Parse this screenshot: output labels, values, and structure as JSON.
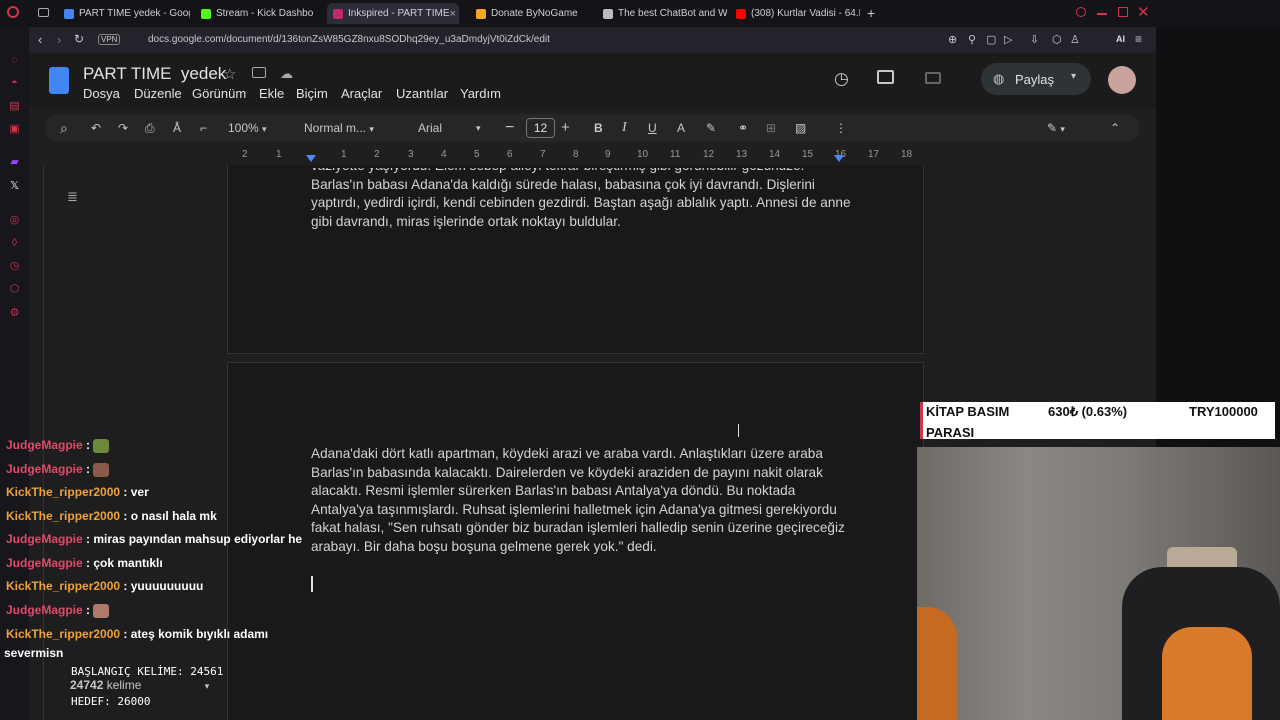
{
  "browser": {
    "tabs": [
      {
        "label": "PART TIME yedek - Goog",
        "color": "#4285f4",
        "active": false
      },
      {
        "label": "Stream - Kick Dashbo",
        "color": "#53fc18",
        "active": false
      },
      {
        "label": "Inkspired - PART TIME",
        "color": "#c02a6b",
        "active": true,
        "close": "×"
      },
      {
        "label": "Donate ByNoGame",
        "color": "#f5a623",
        "active": false
      },
      {
        "label": "The best ChatBot and Wi",
        "color": "#bbbbbb",
        "active": false
      },
      {
        "label": "(308) Kurtlar Vadisi - 64.B",
        "color": "#ff0000",
        "active": false
      }
    ],
    "new_tab": "+",
    "vpn_label": "VPN",
    "url": "docs.google.com/document/d/136tonZsW85GZ8nxu8SODhq29ey_u3aDmdyjVt0iZdCk/edit",
    "ai_label": "AI"
  },
  "docs": {
    "title": "PART TIME  yedek",
    "menus": [
      "Dosya",
      "Düzenle",
      "Görünüm",
      "Ekle",
      "Biçim",
      "Araçlar",
      "Uzantılar",
      "Yardım"
    ],
    "share_label": "Paylaş",
    "toolbar": {
      "zoom": "100%",
      "style": "Normal m...",
      "font": "Arial",
      "font_size": "12",
      "minus": "−",
      "plus": "+",
      "bold": "B",
      "italic": "I",
      "underline": "U",
      "text_color": "A"
    },
    "ruler_numbers": [
      "2",
      "1",
      "1",
      "2",
      "3",
      "4",
      "5",
      "6",
      "7",
      "8",
      "9",
      "10",
      "11",
      "12",
      "13",
      "14",
      "15",
      "16",
      "17",
      "18"
    ],
    "page1_text": "vaziyette yaşıyordu. Elem sebep aileyi tekrar bireştirmiş gibi görünebilir gözünüze. Barlas'ın babası Adana'da kaldığı sürede halası, babasına çok iyi davrandı. Dişlerini yaptırdı, yedirdi içirdi, kendi cebinden gezdirdi. Baştan aşağı ablalık yaptı. Annesi de anne gibi davrandı, miras işlerinde ortak noktayı buldular.",
    "page2_text": "Adana'daki dört katlı apartman, köydeki arazi ve araba vardı. Anlaştıkları üzere araba Barlas'ın babasında kalacaktı. Dairelerden ve köydeki araziden de payını nakit olarak alacaktı. Resmi işlemler sürerken Barlas'ın babası Antalya'ya döndü. Bu noktada Antalya'ya taşınmışlardı. Ruhsat işlemlerini halletmek için Adana'ya gitmesi gerekiyordu fakat halası, \"Sen ruhsatı gönder biz buradan işlemleri halledip senin üzerine geçireceğiz arabayı. Bir daha boşu boşuna gelmene gerek yok.\" dedi.",
    "word_count": "24742",
    "word_count_label": "kelime"
  },
  "chat": [
    {
      "user": "JudgeMagpie",
      "color": "red",
      "text": "",
      "emote": "#6a8a3a"
    },
    {
      "user": "JudgeMagpie",
      "color": "red",
      "text": "",
      "emote": "#8a5a4a"
    },
    {
      "user": "KickThe_ripper2000",
      "color": "orange",
      "text": "ver"
    },
    {
      "user": "KickThe_ripper2000",
      "color": "orange",
      "text": "o nasıl hala mk"
    },
    {
      "user": "JudgeMagpie",
      "color": "red",
      "text": "miras payından mahsup ediyorlar he"
    },
    {
      "user": "JudgeMagpie",
      "color": "red",
      "text": "çok mantıklı"
    },
    {
      "user": "KickThe_ripper2000",
      "color": "orange",
      "text": "yuuuuuuuuu"
    },
    {
      "user": "JudgeMagpie",
      "color": "red",
      "text": "",
      "emote": "#b07a6a"
    },
    {
      "user": "KickThe_ripper2000",
      "color": "orange",
      "text": "ateş komik bıyıklı adamı"
    }
  ],
  "chat_wrap": "severmisn",
  "counter": {
    "start": "BAŞLANGIÇ KELİME: 24561",
    "target": "HEDEF: 26000"
  },
  "stock": {
    "name_line1": "KİTAP BASIM",
    "name_line2": "PARASI",
    "value": "630₺ (0.63%)",
    "goal": "TRY100000"
  }
}
